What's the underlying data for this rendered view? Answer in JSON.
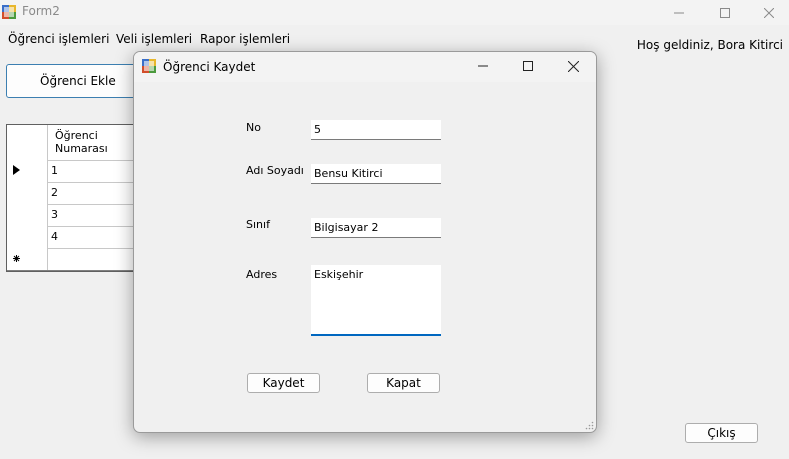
{
  "main_window": {
    "title": "Form2",
    "menu": [
      "Öğrenci işlemleri",
      "Veli işlemleri",
      "Rapor işlemleri"
    ],
    "welcome_text": "Hoş geldiniz, Bora Kitirci",
    "add_student_button": "Öğrenci Ekle",
    "exit_button": "Çıkış"
  },
  "grid": {
    "column_header": "Öğrenci Numarası",
    "rows": [
      "1",
      "2",
      "3",
      "4"
    ]
  },
  "dialog": {
    "title": "Öğrenci Kaydet",
    "labels": {
      "no": "No",
      "name": "Adı Soyadı",
      "class": "Sınıf",
      "address": "Adres"
    },
    "values": {
      "no": "5",
      "name": "Bensu Kitirci",
      "class": "Bilgisayar 2",
      "address": "Eskişehir"
    },
    "save_button": "Kaydet",
    "close_button": "Kapat"
  },
  "colors": {
    "accent": "#0067c0",
    "button_border_focus": "#3c7fb1"
  }
}
